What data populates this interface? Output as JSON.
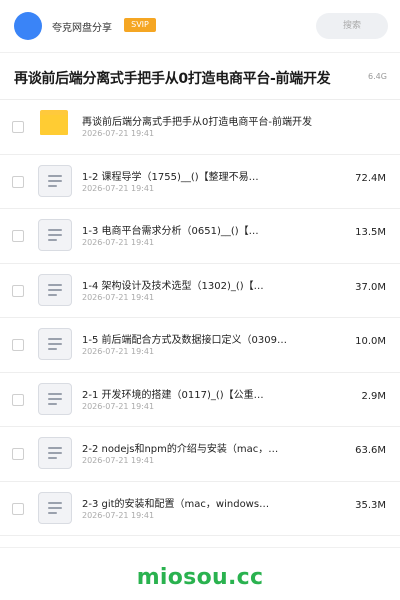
{
  "header": {
    "brand": "夸克网盘分享",
    "badge": "SVIP",
    "search_placeholder": "搜索"
  },
  "share": {
    "title": "再谈前后端分离式手把手从0打造电商平台-前端开发",
    "total_size": "6.4G"
  },
  "files": [
    {
      "type": "folder",
      "name": "再谈前后端分离式手把手从0打造电商平台-前端开发",
      "date": "2026-07-21 19:41",
      "size": ""
    },
    {
      "type": "file",
      "name": "1-2 课程导学（1755)__()【整理不易…",
      "date": "2026-07-21 19:41",
      "size": "72.4M"
    },
    {
      "type": "file",
      "name": "1-3 电商平台需求分析（0651)__()【…",
      "date": "2026-07-21 19:41",
      "size": "13.5M"
    },
    {
      "type": "file",
      "name": "1-4 架构设计及技术选型（1302)_()【…",
      "date": "2026-07-21 19:41",
      "size": "37.0M"
    },
    {
      "type": "file",
      "name": "1-5 前后端配合方式及数据接口定义（0309…",
      "date": "2026-07-21 19:41",
      "size": "10.0M"
    },
    {
      "type": "file",
      "name": "2-1 开发环境的搭建（0117)_()【公重…",
      "date": "2026-07-21 19:41",
      "size": "2.9M"
    },
    {
      "type": "file",
      "name": "2-2 nodejs和npm的介绍与安装（mac，…",
      "date": "2026-07-21 19:41",
      "size": "63.6M"
    },
    {
      "type": "file",
      "name": "2-3 git的安装和配置（mac，windows…",
      "date": "2026-07-21 19:41",
      "size": "35.3M"
    }
  ],
  "watermark": "miosou.cc",
  "colors": {
    "avatar": "#3a84f7",
    "svip_badge": "#f5a623",
    "folder": "#ffcc33",
    "watermark": "#2ab24f"
  }
}
